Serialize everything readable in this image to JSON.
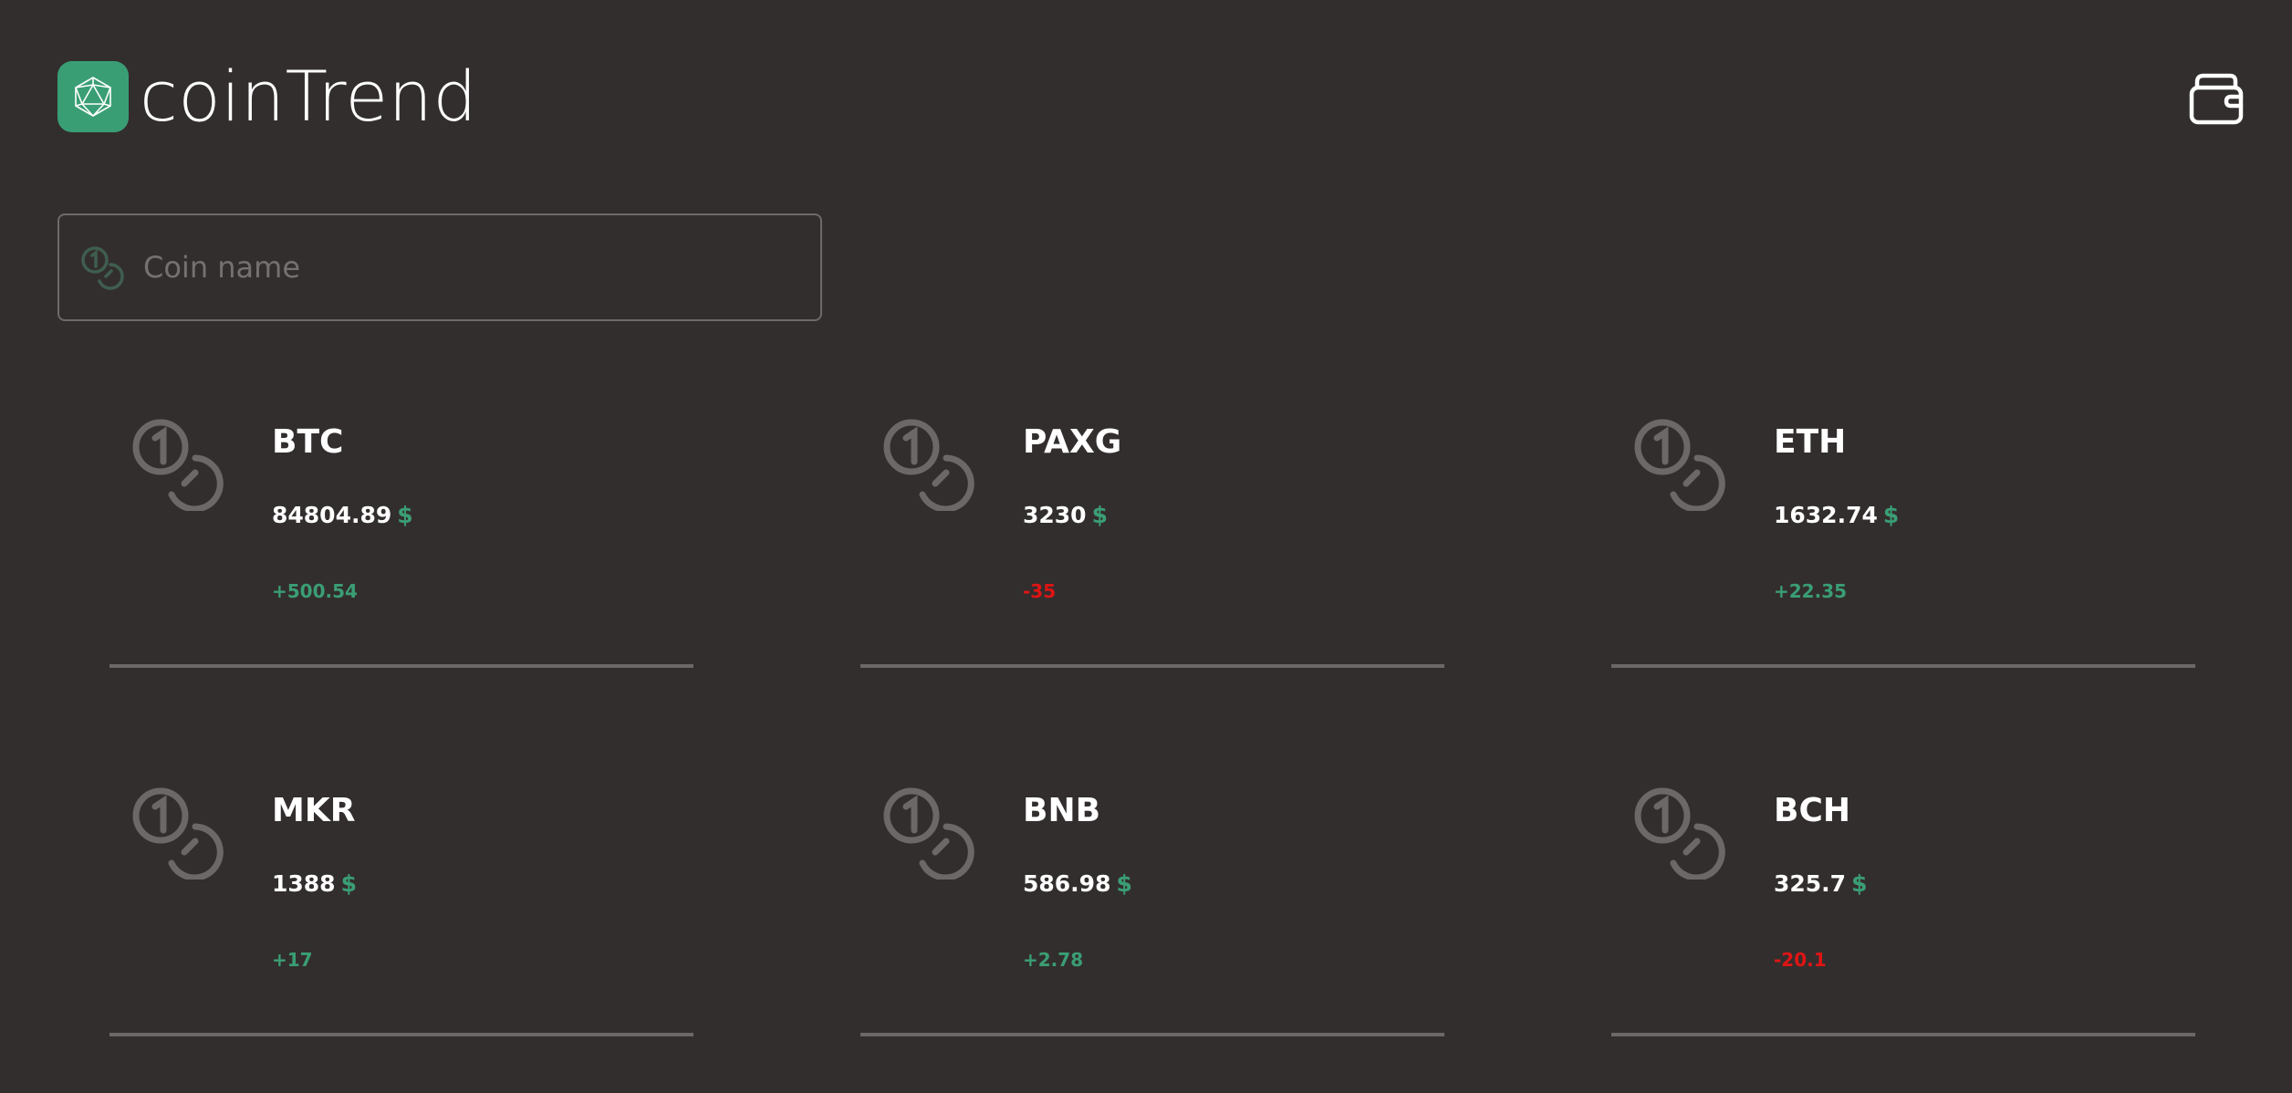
{
  "app": {
    "name": "coinTrend",
    "accent": "#3a9e74",
    "negative": "#e01414"
  },
  "header": {
    "logo_icon": "polyhedron-icon",
    "wallet_icon": "wallet-icon"
  },
  "search": {
    "placeholder": "Coin name",
    "value": "",
    "icon": "coins-icon"
  },
  "coins": [
    {
      "symbol": "BTC",
      "price": "84804.89",
      "currency": "$",
      "change": "+500.54",
      "direction": "up"
    },
    {
      "symbol": "PAXG",
      "price": "3230",
      "currency": "$",
      "change": "-35",
      "direction": "down"
    },
    {
      "symbol": "ETH",
      "price": "1632.74",
      "currency": "$",
      "change": "+22.35",
      "direction": "up"
    },
    {
      "symbol": "MKR",
      "price": "1388",
      "currency": "$",
      "change": "+17",
      "direction": "up"
    },
    {
      "symbol": "BNB",
      "price": "586.98",
      "currency": "$",
      "change": "+2.78",
      "direction": "up"
    },
    {
      "symbol": "BCH",
      "price": "325.7",
      "currency": "$",
      "change": "-20.1",
      "direction": "down"
    }
  ]
}
